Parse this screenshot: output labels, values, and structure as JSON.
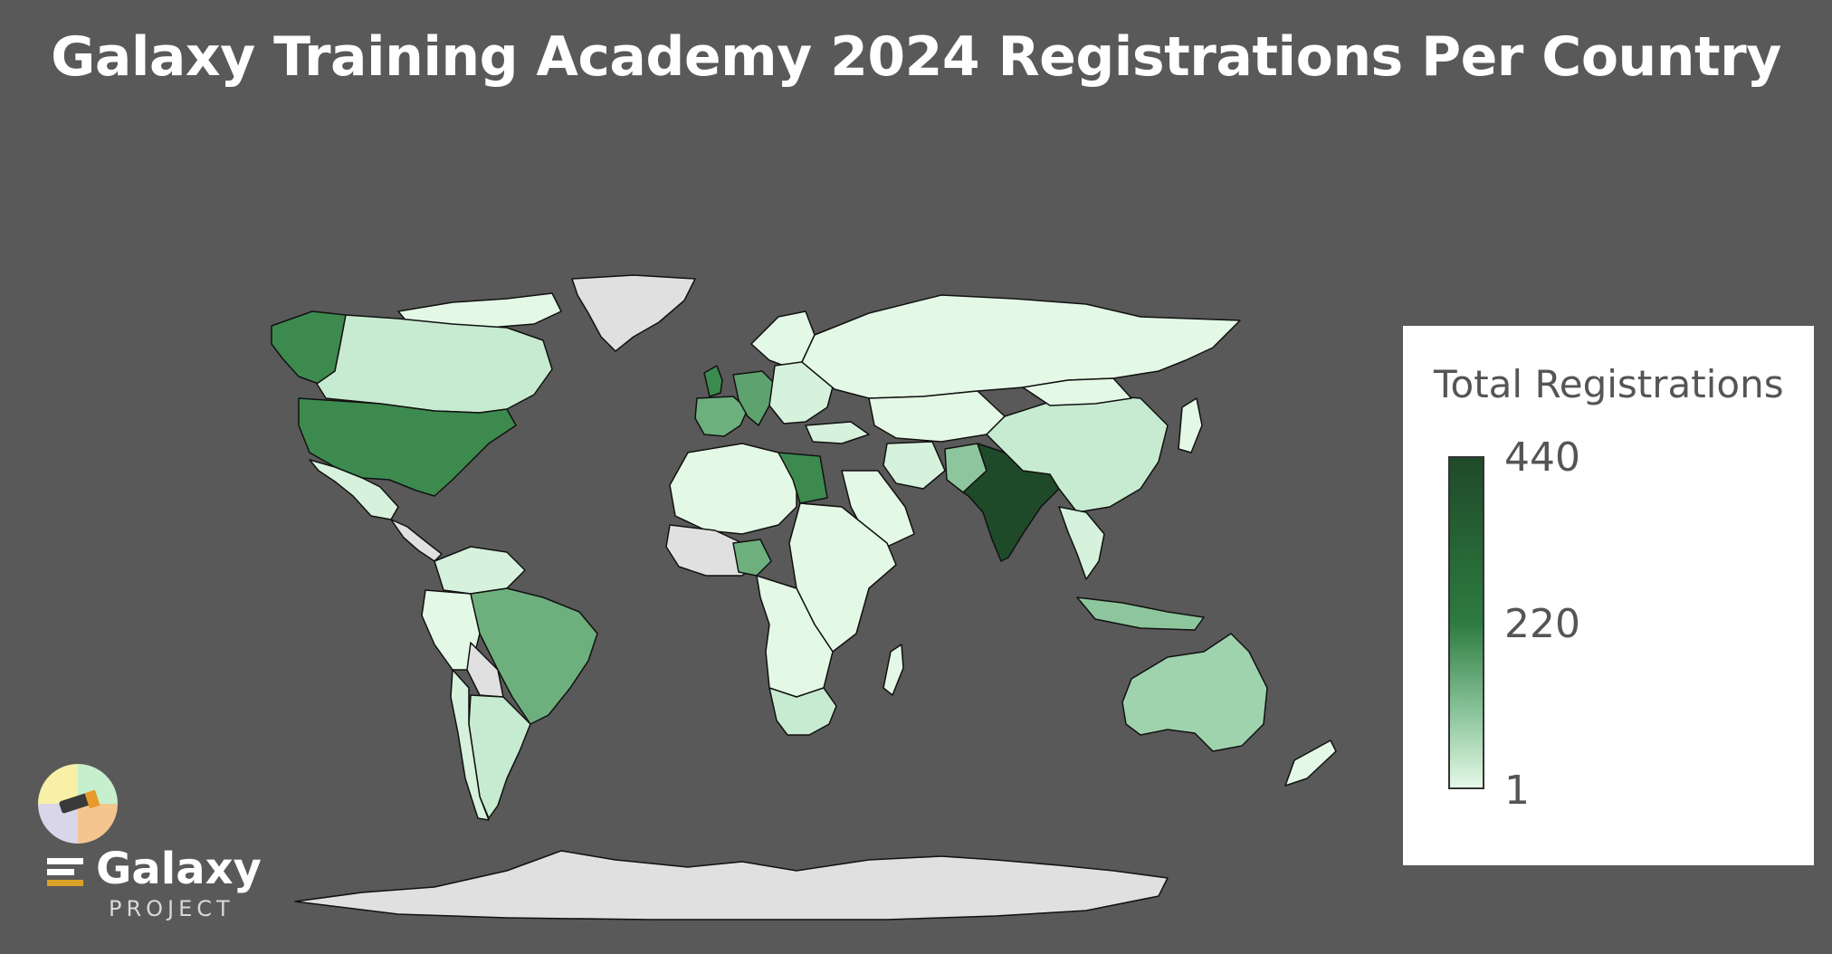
{
  "title": "Galaxy Training Academy 2024 Registrations Per Country",
  "legend": {
    "title": "Total Registrations",
    "max_label": "440",
    "mid_label": "220",
    "min_label": "1",
    "scale_colors": [
      "#1f4a29",
      "#2d7b40",
      "#8dc69d",
      "#e4f8e6"
    ]
  },
  "map_colors": {
    "background": "#595959",
    "no_data": "#e0e0e0",
    "border": "#111111"
  },
  "logo": {
    "word": "Galaxy",
    "sub": "PROJECT"
  }
}
